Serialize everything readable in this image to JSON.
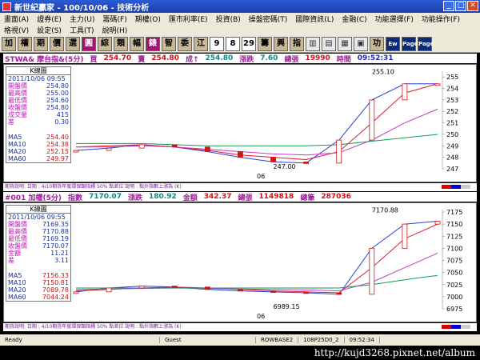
{
  "window": {
    "title": "新世紀贏家 - 100/10/06 - 技術分析"
  },
  "menu_row1": [
    "畫面(A)",
    "證券(E)",
    "主力(U)",
    "籌碼(F)",
    "期權(O)",
    "匯市利率(E)",
    "投資(B)",
    "操盤密碼(T)",
    "國際資訊(L)",
    "金融(C)",
    "功能選擇(F)",
    "功能操作(F)"
  ],
  "menu_row2": [
    "格視(V)",
    "設定(S)",
    "工具(T)",
    "說明(H)"
  ],
  "toolbar": [
    "加",
    "權",
    "期",
    "價",
    "選",
    "圓",
    "綜",
    "類",
    "幅",
    "錶",
    "智",
    "委",
    "江",
    "9",
    "8",
    "29",
    "籌",
    "興",
    "指",
    "",
    "",
    "",
    "",
    "功",
    "Ew",
    "Page",
    "Page"
  ],
  "top": {
    "header": {
      "symbol": "STWA& 摩台指&(5分)",
      "buy_label": "買",
      "buy": "254.70",
      "sell_label": "賣",
      "sell": "254.80",
      "deal_label": "成↑",
      "deal": "254.80",
      "change_label": "漲跌",
      "change": "7.60",
      "volume_label": "總張",
      "volume": "19990",
      "time_label": "時間",
      "time": "09:52:31"
    },
    "info": {
      "title": "K線圖",
      "date": "2011/10/06 09:55",
      "rows": [
        [
          "開盤價",
          "254.80"
        ],
        [
          "最高價",
          "255.00"
        ],
        [
          "最低價",
          "254.60"
        ],
        [
          "收盤價",
          "254.80"
        ],
        [
          "成交量",
          "415"
        ],
        [
          "差",
          "0.30"
        ]
      ],
      "ma": [
        [
          "MA5",
          "254.40"
        ],
        [
          "MA10",
          "254.38"
        ],
        [
          "MA20",
          "252.15"
        ],
        [
          "MA60",
          "249.97"
        ]
      ]
    },
    "y_ticks": [
      "255",
      "254",
      "253",
      "252",
      "251",
      "250",
      "249",
      "248",
      "247"
    ],
    "x_tick": "06",
    "peak_label": "255.10",
    "low_label": "247.00",
    "foot": "期貨說明: 日期 : 4/10期貨年度環保類指標 50% 點差位 說明 : 點外指數上漲為 (K)"
  },
  "bottom": {
    "header": {
      "symbol": "#001 加權(5分)",
      "idx_label": "指數",
      "idx": "7170.07",
      "chg_label": "漲跌",
      "chg": "180.92",
      "amt_label": "金額",
      "amt": "342.37",
      "vol_label": "總張",
      "vol": "1149818",
      "cnt_label": "總筆",
      "cnt": "287036"
    },
    "info": {
      "title": "K線圖",
      "date": "2011/10/06 09:55",
      "rows": [
        [
          "開盤價",
          "7169.35"
        ],
        [
          "最高價",
          "7170.88"
        ],
        [
          "最低價",
          "7169.19"
        ],
        [
          "收盤價",
          "7170.07"
        ],
        [
          "金額",
          "11.21"
        ],
        [
          "差",
          "3.11"
        ]
      ],
      "ma": [
        [
          "MA5",
          "7156.33"
        ],
        [
          "MA10",
          "7150.81"
        ],
        [
          "MA20",
          "7089.78"
        ],
        [
          "MA60",
          "7044.24"
        ]
      ]
    },
    "y_ticks": [
      "7175",
      "7150",
      "7125",
      "7100",
      "7075",
      "7050",
      "7025",
      "7000",
      "6975"
    ],
    "x_tick": "06",
    "peak_label": "7170.88",
    "low_label": "6989.15",
    "foot": "期貨說明: 日期 : 4/10期貨年度環保類指標 50% 點差位 說明 : 點外指數上漲為 (K)"
  },
  "status": [
    "Ready",
    "Guest",
    "ROWBASE2",
    "108P25D0_2",
    "09:52:34"
  ],
  "watermark": "http://kujd3268.pixnet.net/album",
  "chart_data": [
    {
      "type": "line",
      "title": "STWA& 摩台指&(5分)",
      "y_range": [
        247,
        255.5
      ],
      "peak": 255.1,
      "low": 247.0,
      "series": [
        {
          "name": "MA5",
          "values": [
            248.6,
            248.8,
            249.1,
            248.9,
            248.5,
            248.0,
            247.6,
            247.5,
            249.5,
            253.0,
            254.4,
            254.4
          ]
        },
        {
          "name": "MA10",
          "values": [
            248.9,
            249.0,
            249.1,
            248.9,
            248.6,
            248.2,
            248.0,
            247.8,
            248.5,
            251.0,
            253.6,
            254.4
          ]
        },
        {
          "name": "MA20",
          "values": [
            248.9,
            248.9,
            249.0,
            248.9,
            248.7,
            248.5,
            248.3,
            248.2,
            248.4,
            249.5,
            251.0,
            252.2
          ]
        },
        {
          "name": "MA60",
          "values": [
            249.2,
            249.2,
            249.2,
            249.1,
            249.0,
            249.0,
            249.0,
            249.0,
            249.1,
            249.4,
            249.7,
            250.0
          ]
        }
      ]
    },
    {
      "type": "line",
      "title": "#001 加權(5分)",
      "y_range": [
        6975,
        7180
      ],
      "peak": 7170.88,
      "low": 6989.15,
      "series": [
        {
          "name": "MA5",
          "values": [
            7010,
            7018,
            7022,
            7020,
            7015,
            7012,
            7010,
            7008,
            7005,
            7100,
            7150,
            7156
          ]
        },
        {
          "name": "MA10",
          "values": [
            7012,
            7015,
            7018,
            7020,
            7018,
            7015,
            7012,
            7010,
            7008,
            7060,
            7120,
            7150
          ]
        },
        {
          "name": "MA20",
          "values": [
            7015,
            7016,
            7017,
            7018,
            7017,
            7016,
            7015,
            7014,
            7012,
            7030,
            7060,
            7090
          ]
        },
        {
          "name": "MA60",
          "values": [
            7018,
            7018,
            7018,
            7018,
            7018,
            7018,
            7018,
            7018,
            7018,
            7025,
            7035,
            7044
          ]
        }
      ]
    }
  ]
}
